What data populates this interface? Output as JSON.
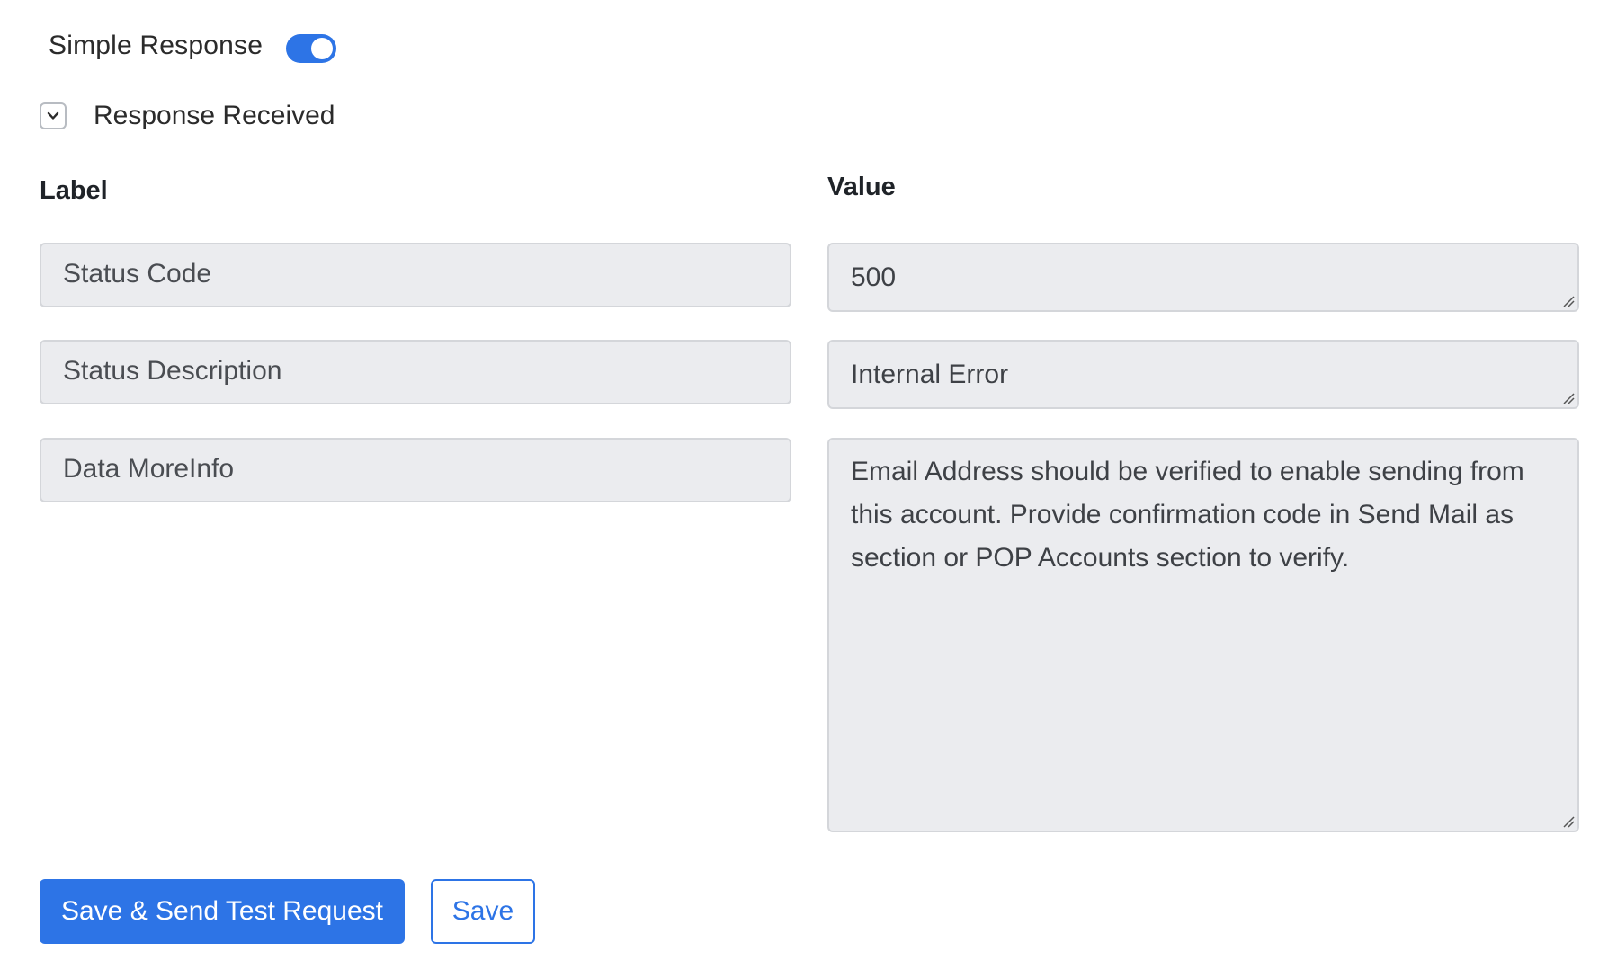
{
  "simple_response": {
    "label": "Simple Response",
    "enabled": true,
    "accent_color": "#2d74e6"
  },
  "response_received": {
    "label": "Response Received",
    "icon": "chevron-down-icon"
  },
  "table": {
    "label_header": "Label",
    "value_header": "Value",
    "rows": [
      {
        "label": "Status Code",
        "value": "500"
      },
      {
        "label": "Status Description",
        "value": "Internal Error"
      },
      {
        "label": "Data MoreInfo",
        "value": "Email Address should be verified to enable sending from this account. Provide confirmation code in Send Mail as section or POP Accounts section to verify."
      }
    ]
  },
  "actions": {
    "save_send_label": "Save & Send Test Request",
    "save_label": "Save"
  }
}
